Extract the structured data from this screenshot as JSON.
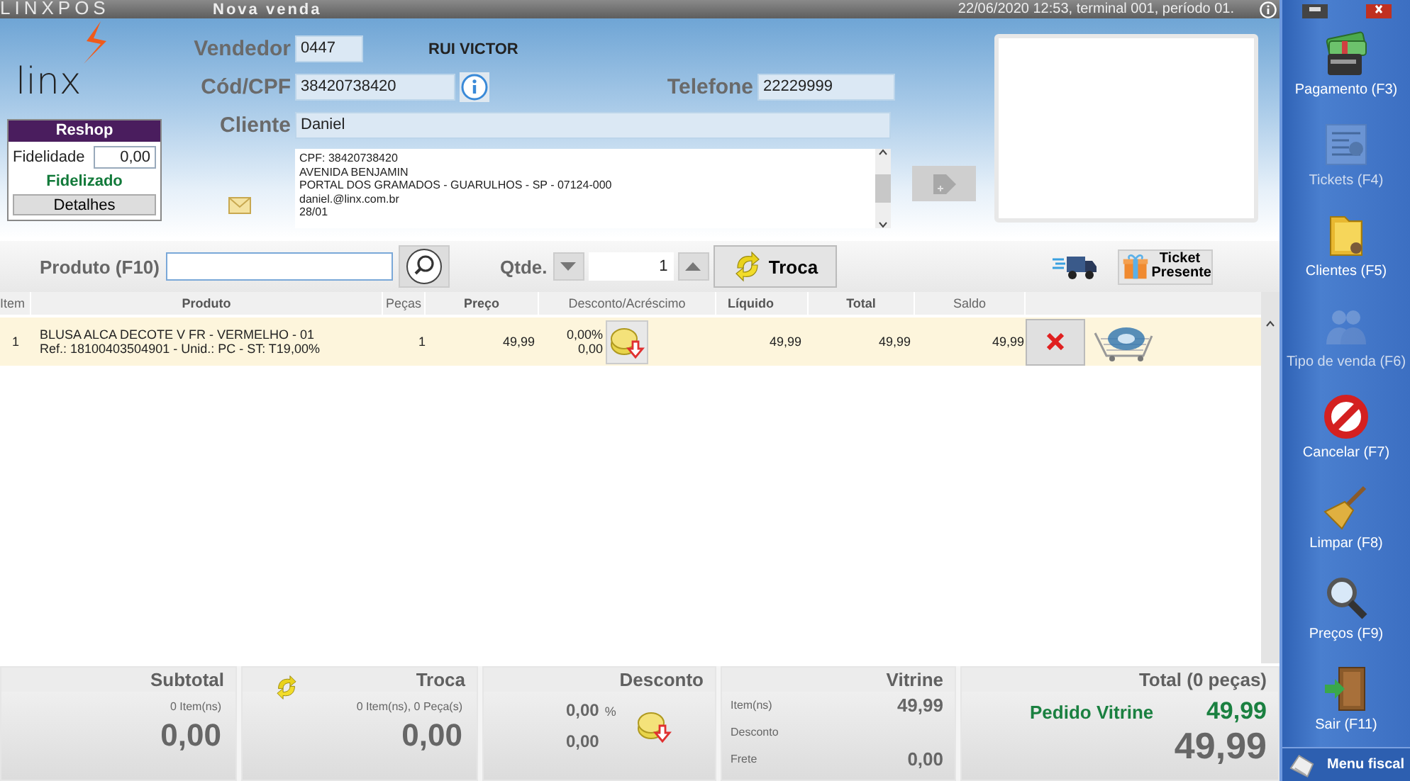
{
  "title_bar": {
    "app_name": "LINXPOS",
    "screen_title": "Nova venda",
    "session": "22/06/2020 12:53, terminal 001, período 01."
  },
  "logo_text": "linx",
  "reshop": {
    "title": "Reshop",
    "fidelidade_label": "Fidelidade",
    "fidelidade_value": "0,00",
    "status": "Fidelizado",
    "details_button": "Detalhes"
  },
  "header": {
    "vendedor_label": "Vendedor",
    "vendedor_code": "0447",
    "vendedor_name": "RUI VICTOR",
    "cpf_label": "Cód/CPF",
    "cpf_value": "38420738420",
    "telefone_label": "Telefone",
    "telefone_value": "22229999",
    "cliente_label": "Cliente",
    "cliente_value": "Daniel",
    "address_lines": [
      "CPF: 38420738420",
      "AVENIDA BENJAMIN",
      "PORTAL DOS GRAMADOS - GUARULHOS - SP - 07124-000",
      "daniel.@linx.com.br",
      "28/01"
    ]
  },
  "product_bar": {
    "label": "Produto (F10)",
    "qty_label": "Qtde.",
    "qty_value": "1",
    "troca_button": "Troca",
    "ticket_button": "Ticket Presente"
  },
  "table": {
    "columns": [
      "Item",
      "Produto",
      "Peças",
      "Preço",
      "Desconto/Acréscimo",
      "Líquido",
      "Total",
      "Saldo"
    ],
    "rows": [
      {
        "item": "1",
        "produto": "BLUSA ALCA DECOTE V FR - VERMELHO - 01",
        "ref": "Ref.: 18100403504901 - Unid.: PC - ST: T19,00%",
        "pecas": "1",
        "preco": "49,99",
        "desconto_pct": "0,00%",
        "desconto_valor": "0,00",
        "liquido": "49,99",
        "total": "49,99",
        "saldo": "49,99",
        "selected": true
      }
    ]
  },
  "totals": {
    "subtotal": {
      "title": "Subtotal",
      "count": "0 Item(ns)",
      "value": "0,00"
    },
    "troca": {
      "title": "Troca",
      "count": "0 Item(ns), 0 Peça(s)",
      "value": "0,00"
    },
    "desconto": {
      "title": "Desconto",
      "pct": "0,00",
      "pct_sign": "%",
      "value": "0,00"
    },
    "vitrine": {
      "title": "Vitrine",
      "rows": [
        {
          "label": "Item(ns)",
          "value": "49,99"
        },
        {
          "label": "Desconto"
        },
        {
          "label": "Frete",
          "value": "0,00"
        }
      ]
    },
    "total": {
      "title": "Total (0 peças)",
      "pedido_label": "Pedido Vitrine",
      "pedido_value": "49,99",
      "value": "49,99"
    }
  },
  "sidebar": {
    "items": [
      {
        "label": "Pagamento (F3)",
        "kind": "money",
        "disabled": false
      },
      {
        "label": "Tickets (F4)",
        "kind": "ticket",
        "disabled": true
      },
      {
        "label": "Clientes (F5)",
        "kind": "folder",
        "disabled": false
      },
      {
        "label": "Tipo de venda (F6)",
        "kind": "people",
        "disabled": true
      },
      {
        "label": "Cancelar (F7)",
        "kind": "cancel",
        "disabled": false
      },
      {
        "label": "Limpar (F8)",
        "kind": "broom",
        "disabled": false
      },
      {
        "label": "Preços (F9)",
        "kind": "search",
        "disabled": false
      },
      {
        "label": "Sair (F11)",
        "kind": "door",
        "disabled": false
      }
    ],
    "menu_fiscal": "Menu fiscal"
  }
}
